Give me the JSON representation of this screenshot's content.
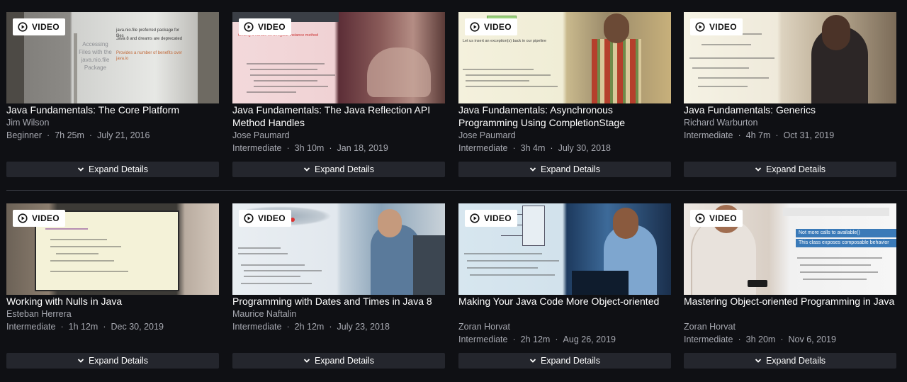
{
  "badge_label": "VIDEO",
  "expand_label": "Expand Details",
  "meta_separator": "·",
  "courses": [
    {
      "title": "Java Fundamentals: The Core Platform",
      "author": "Jim Wilson",
      "level": "Beginner",
      "duration": "7h 25m",
      "date": "July 21, 2016",
      "thumb_text": [
        "Accessing Files with the java.nio.file Package",
        "java.nio.file preferred package for files",
        "Java 8 and dreams are deprecated",
        "Provides a number of benefits over java.io"
      ]
    },
    {
      "title": "Java Fundamentals: The Java Reflection API Method Handles",
      "author": "Jose Paumard",
      "level": "Intermediate",
      "duration": "3h 10m",
      "date": "Jan 18, 2019",
      "thumb_text": [
        "Getting a handle on a regular instance method"
      ]
    },
    {
      "title": "Java Fundamentals: Asynchronous Programming Using CompletionStage",
      "author": "Jose Paumard",
      "level": "Intermediate",
      "duration": "3h 4m",
      "date": "July 30, 2018",
      "thumb_text": [
        "Let us insert an exception(s) back in our pipeline"
      ]
    },
    {
      "title": "Java Fundamentals: Generics",
      "author": "Richard Warburton",
      "level": "Intermediate",
      "duration": "4h 7m",
      "date": "Oct 31, 2019",
      "thumb_text": []
    },
    {
      "title": "Working with Nulls in Java",
      "author": "Esteban Herrera",
      "level": "Intermediate",
      "duration": "1h 12m",
      "date": "Dec 30, 2019",
      "thumb_text": []
    },
    {
      "title": "Programming with Dates and Times in Java 8",
      "author": "Maurice Naftalin",
      "level": "Intermediate",
      "duration": "2h 12m",
      "date": "July 23, 2018",
      "thumb_text": []
    },
    {
      "title": "Making Your Java Code More Object-oriented",
      "author": "Zoran Horvat",
      "level": "Intermediate",
      "duration": "2h 12m",
      "date": "Aug 26, 2019",
      "thumb_text": []
    },
    {
      "title": "Mastering Object-oriented Programming in Java",
      "author": "Zoran Horvat",
      "level": "Intermediate",
      "duration": "3h 20m",
      "date": "Nov 6, 2019",
      "thumb_text": [
        "Not more calls to available()",
        "This class exposes composable behavior"
      ]
    }
  ]
}
